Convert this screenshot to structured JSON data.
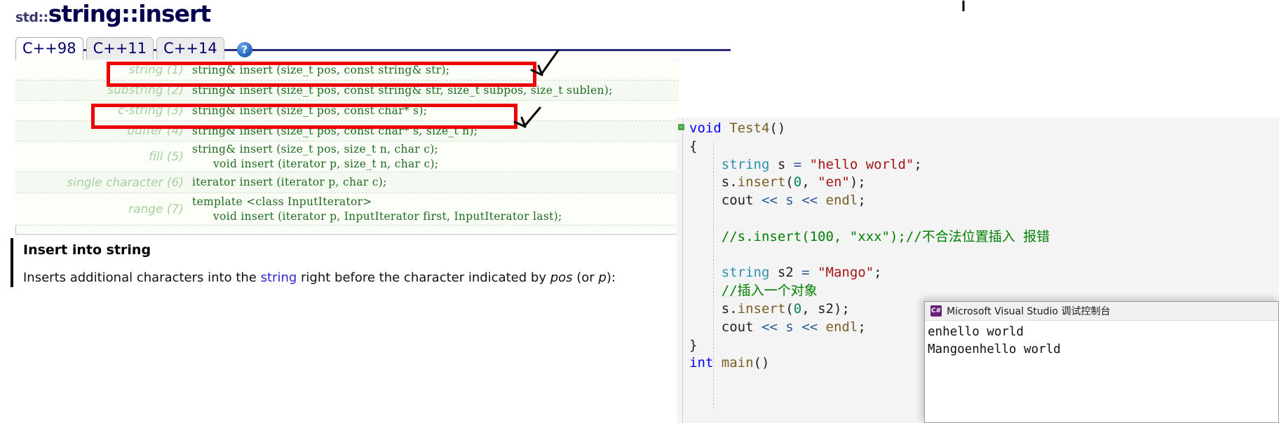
{
  "reference": {
    "title_namespace": "std::",
    "title_name": "string::insert",
    "tabs": [
      {
        "label": "C++98",
        "active": true
      },
      {
        "label": "C++11",
        "active": false
      },
      {
        "label": "C++14",
        "active": false
      }
    ],
    "help_icon": "?",
    "signatures": [
      {
        "label": "string (1)",
        "code": "string& insert (size_t pos, const string& str);"
      },
      {
        "label": "substring (2)",
        "code": "string& insert (size_t pos, const string& str, size_t subpos, size_t sublen);"
      },
      {
        "label": "c-string (3)",
        "code": "string& insert (size_t pos, const char* s);"
      },
      {
        "label": "buffer (4)",
        "code": "string& insert (size_t pos, const char* s, size_t n);"
      },
      {
        "label": "fill (5)",
        "code": "string& insert (size_t pos, size_t n, char c);",
        "code2": "void insert (iterator p, size_t n, char c);"
      },
      {
        "label": "single character (6)",
        "code": "iterator insert (iterator p, char c);"
      },
      {
        "label": "range (7)",
        "code": "template <class InputIterator>",
        "code2": "void insert (iterator p, InputIterator first, InputIterator last);"
      }
    ],
    "description_heading": "Insert into string",
    "description_parts": {
      "p1": "Inserts additional characters into the ",
      "link": "string",
      "p2": " right before the character indicated by ",
      "em1": "pos",
      "p3": " (or ",
      "em2": "p",
      "p4": "):"
    }
  },
  "editor": {
    "lines": [
      [
        {
          "t": "void ",
          "c": "k"
        },
        {
          "t": "Test4",
          "c": "fn"
        },
        {
          "t": "()",
          "c": "id"
        }
      ],
      [
        {
          "t": "{",
          "c": "id"
        }
      ],
      [
        {
          "t": "    ",
          "c": "id"
        },
        {
          "t": "string",
          "c": "ty"
        },
        {
          "t": " s ",
          "c": "id"
        },
        {
          "t": "=",
          "c": "op"
        },
        {
          "t": " ",
          "c": "id"
        },
        {
          "t": "\"hello world\"",
          "c": "st"
        },
        {
          "t": ";",
          "c": "id"
        }
      ],
      [
        {
          "t": "    s.",
          "c": "id"
        },
        {
          "t": "insert",
          "c": "fn"
        },
        {
          "t": "(",
          "c": "id"
        },
        {
          "t": "0",
          "c": "num"
        },
        {
          "t": ", ",
          "c": "id"
        },
        {
          "t": "\"en\"",
          "c": "st"
        },
        {
          "t": ");",
          "c": "id"
        }
      ],
      [
        {
          "t": "    cout ",
          "c": "id"
        },
        {
          "t": "<<",
          "c": "op"
        },
        {
          "t": " ",
          "c": "id"
        },
        {
          "t": "s",
          "c": "op"
        },
        {
          "t": " ",
          "c": "id"
        },
        {
          "t": "<<",
          "c": "op"
        },
        {
          "t": " ",
          "c": "id"
        },
        {
          "t": "endl",
          "c": "fn"
        },
        {
          "t": ";",
          "c": "id"
        }
      ],
      [
        {
          "t": "",
          "c": "id"
        }
      ],
      [
        {
          "t": "    //s.insert(100, \"xxx\");//不合法位置插入 报错",
          "c": "cm"
        }
      ],
      [
        {
          "t": "",
          "c": "id"
        }
      ],
      [
        {
          "t": "    ",
          "c": "id"
        },
        {
          "t": "string",
          "c": "ty"
        },
        {
          "t": " s2 ",
          "c": "id"
        },
        {
          "t": "=",
          "c": "op"
        },
        {
          "t": " ",
          "c": "id"
        },
        {
          "t": "\"Mango\"",
          "c": "st"
        },
        {
          "t": ";",
          "c": "id"
        }
      ],
      [
        {
          "t": "    //插入一个对象",
          "c": "cm"
        }
      ],
      [
        {
          "t": "    s.",
          "c": "id"
        },
        {
          "t": "insert",
          "c": "fn"
        },
        {
          "t": "(",
          "c": "id"
        },
        {
          "t": "0",
          "c": "num"
        },
        {
          "t": ", s2);",
          "c": "id"
        }
      ],
      [
        {
          "t": "    cout ",
          "c": "id"
        },
        {
          "t": "<<",
          "c": "op"
        },
        {
          "t": " ",
          "c": "id"
        },
        {
          "t": "s",
          "c": "op"
        },
        {
          "t": " ",
          "c": "id"
        },
        {
          "t": "<<",
          "c": "op"
        },
        {
          "t": " ",
          "c": "id"
        },
        {
          "t": "endl",
          "c": "fn"
        },
        {
          "t": ";",
          "c": "id"
        }
      ],
      [
        {
          "t": "}",
          "c": "id"
        }
      ],
      [
        {
          "t": "int",
          "c": "k"
        },
        {
          "t": " ",
          "c": "id"
        },
        {
          "t": "main",
          "c": "fn"
        },
        {
          "t": "()",
          "c": "id"
        }
      ]
    ]
  },
  "console": {
    "icon_label": "C#",
    "title": "Microsoft Visual Studio 调试控制台",
    "output": [
      "enhello world",
      "Mangoenhello world"
    ]
  },
  "colors": {
    "annotation_red": "#ee0000",
    "title_blue": "#00004c",
    "signature_green": "#1f6b1f",
    "label_green": "#a8cfa0"
  }
}
